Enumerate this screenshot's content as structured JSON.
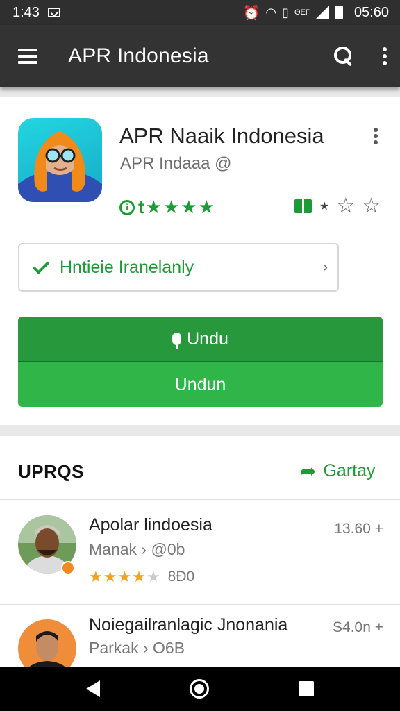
{
  "status_bar": {
    "time": "1:43",
    "clock": "05:60",
    "mini_text": "ΘΕΓ"
  },
  "app_bar": {
    "title": "APR Indonesia"
  },
  "app": {
    "name": "APR Naaik Indonesia",
    "developer": "APR Indaaa @",
    "rating_prefix": "t",
    "stars_filled": 4,
    "install_status": "Hntieie Iranelanly",
    "button_primary": "Undu",
    "button_secondary": "Undun"
  },
  "reviews": {
    "title": "UPRQS",
    "share_label": "Gartay",
    "items": [
      {
        "name": "Apolar lindoesia",
        "sub": "Manak › @0b",
        "meta": "13.60 +",
        "rating": 4,
        "count": "8Đ0"
      },
      {
        "name": "Noiegailranlagic Jnonania",
        "sub": "Parkak › O6B",
        "meta": "S4.0n +"
      }
    ]
  },
  "colors": {
    "accent_green": "#1e9b37",
    "button_dark": "#27983b",
    "button_light": "#2fb548",
    "app_bar": "#333333",
    "star_orange": "#f3a21b"
  }
}
